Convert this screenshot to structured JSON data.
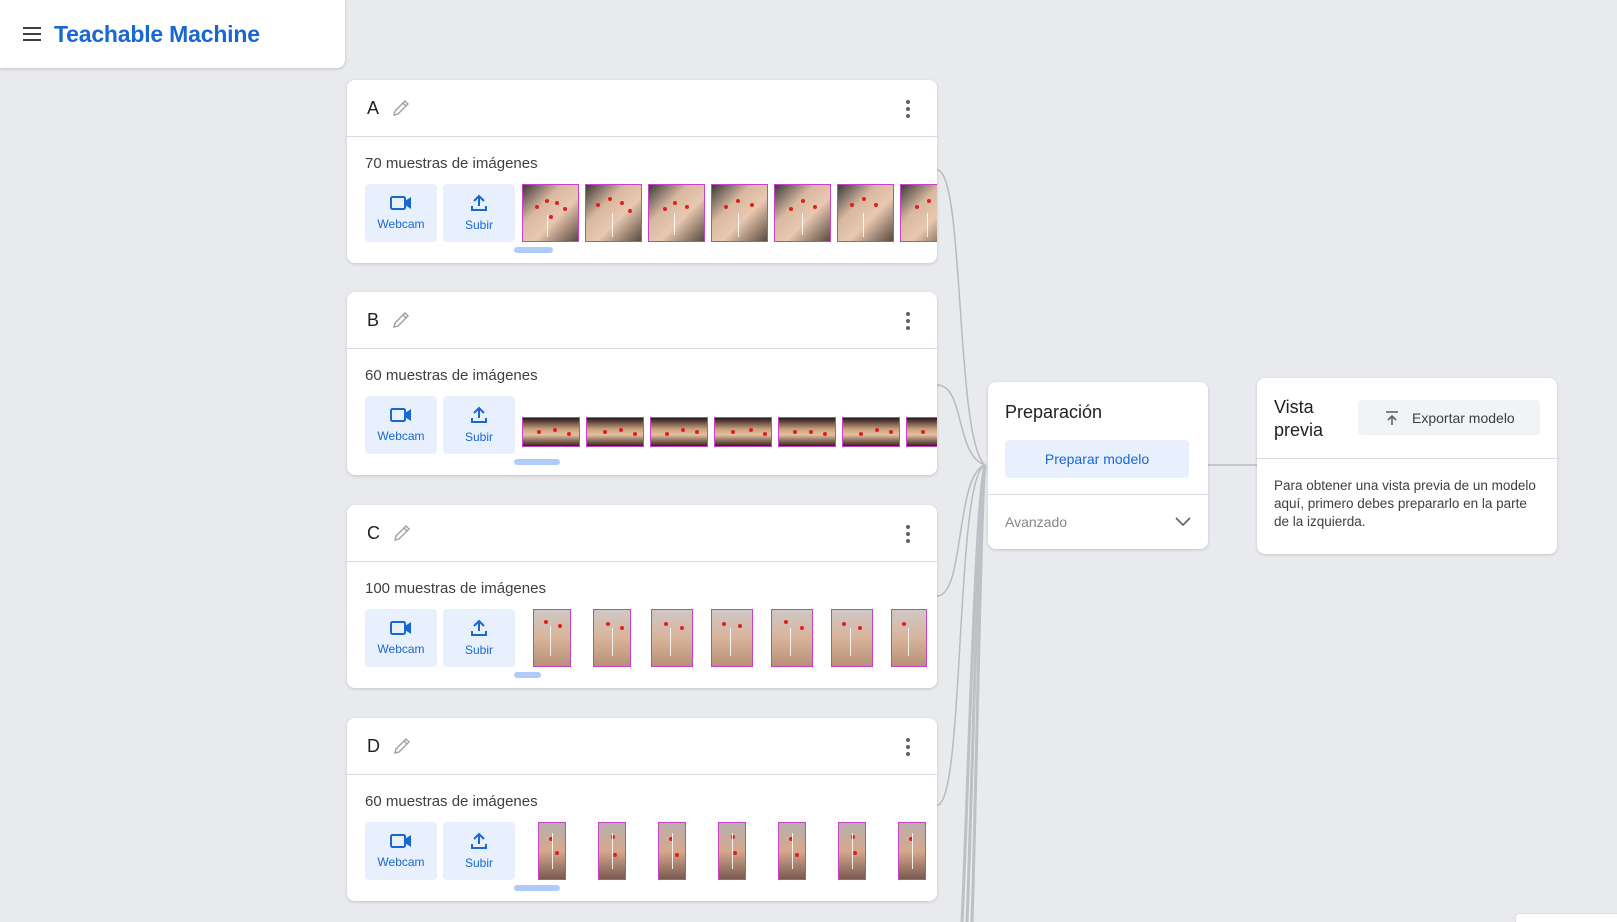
{
  "app": {
    "title": "Teachable Machine"
  },
  "classes": [
    {
      "name": "A",
      "count_label": "70 muestras de imágenes",
      "webcam_label": "Webcam",
      "upload_label": "Subir"
    },
    {
      "name": "B",
      "count_label": "60 muestras de imágenes",
      "webcam_label": "Webcam",
      "upload_label": "Subir"
    },
    {
      "name": "C",
      "count_label": "100 muestras de imágenes",
      "webcam_label": "Webcam",
      "upload_label": "Subir"
    },
    {
      "name": "D",
      "count_label": "60 muestras de imágenes",
      "webcam_label": "Webcam",
      "upload_label": "Subir"
    }
  ],
  "training": {
    "title": "Preparación",
    "train_button": "Preparar modelo",
    "advanced_label": "Avanzado"
  },
  "preview": {
    "title": "Vista previa",
    "export_button": "Exportar modelo",
    "message": "Para obtener una vista previa de un modelo aquí, primero debes prepararlo en la parte de la izquierda."
  },
  "colors": {
    "brand": "#1967d2",
    "button_bg": "#e8f0fe",
    "background": "#e8eaed",
    "thumb_border": "#c940c9",
    "landmark": "#e0201c"
  },
  "icons": {
    "menu": "menu-icon",
    "edit": "pencil-icon",
    "more": "more-vert-icon",
    "webcam": "videocam-icon",
    "upload": "upload-icon",
    "expand": "chevron-down-icon",
    "export": "export-icon"
  }
}
